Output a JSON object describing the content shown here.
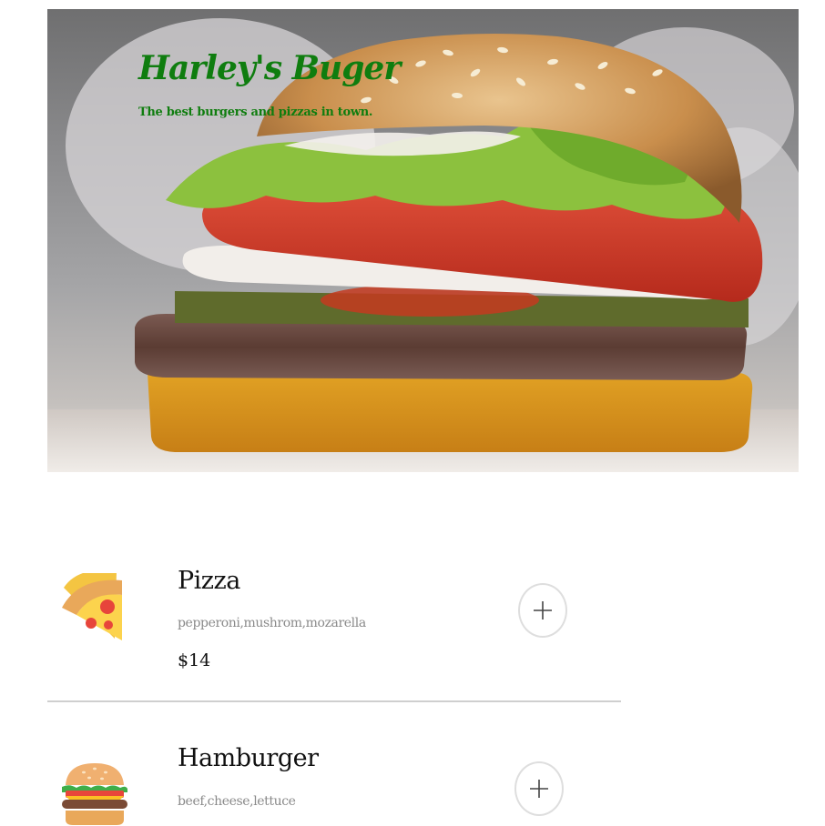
{
  "hero": {
    "title": "Harley's Buger",
    "subtitle": "The best burgers and pizzas in town."
  },
  "menu": {
    "items": [
      {
        "name": "Pizza",
        "description": "pepperoni,mushrom,mozarella",
        "price": "$14",
        "icon": "pizza-slice-icon",
        "add_icon": "plus-icon"
      },
      {
        "name": "Hamburger",
        "description": "beef,cheese,lettuce",
        "icon": "hamburger-icon",
        "add_icon": "plus-icon"
      }
    ]
  },
  "colors": {
    "brand_green": "#0f7d0f",
    "divider": "#cfcfcf",
    "description_gray": "#8a8a8a"
  }
}
